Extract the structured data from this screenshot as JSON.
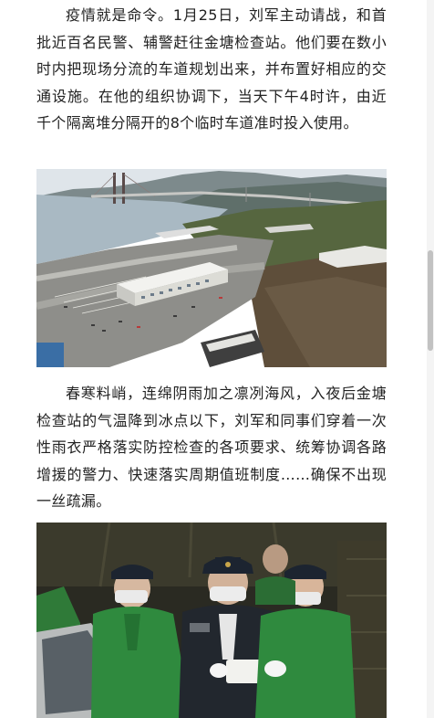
{
  "article": {
    "paragraph_1": "疫情就是命令。1月25日，刘军主动请战，和首批近百名民警、辅警赶往金塘检查站。他们要在数小时内把现场分流的车道规划出来，并布置好相应的交通设施。在他的组织协调下，当天下午4时许，由近千个隔离堆分隔开的8个临时车道准时投入使用。",
    "paragraph_2": "春寒料峭，连绵阴雨加之凛冽海风，入夜后金塘检查站的气温降到冰点以下，刘军和同事们穿着一次性雨衣严格落实防控检查的各项要求、统筹协调各路增援的警力、快速落实周期值班制度……确保不出现一丝疏漏。"
  },
  "images": {
    "aerial_photo": "aerial-checkpoint-photo",
    "night_photo": "night-inspection-photo"
  },
  "colors": {
    "text": "#222222",
    "raincoat_green": "#2f8a3e",
    "police_cap": "#1c2430",
    "sea": "#9fb2bf"
  }
}
